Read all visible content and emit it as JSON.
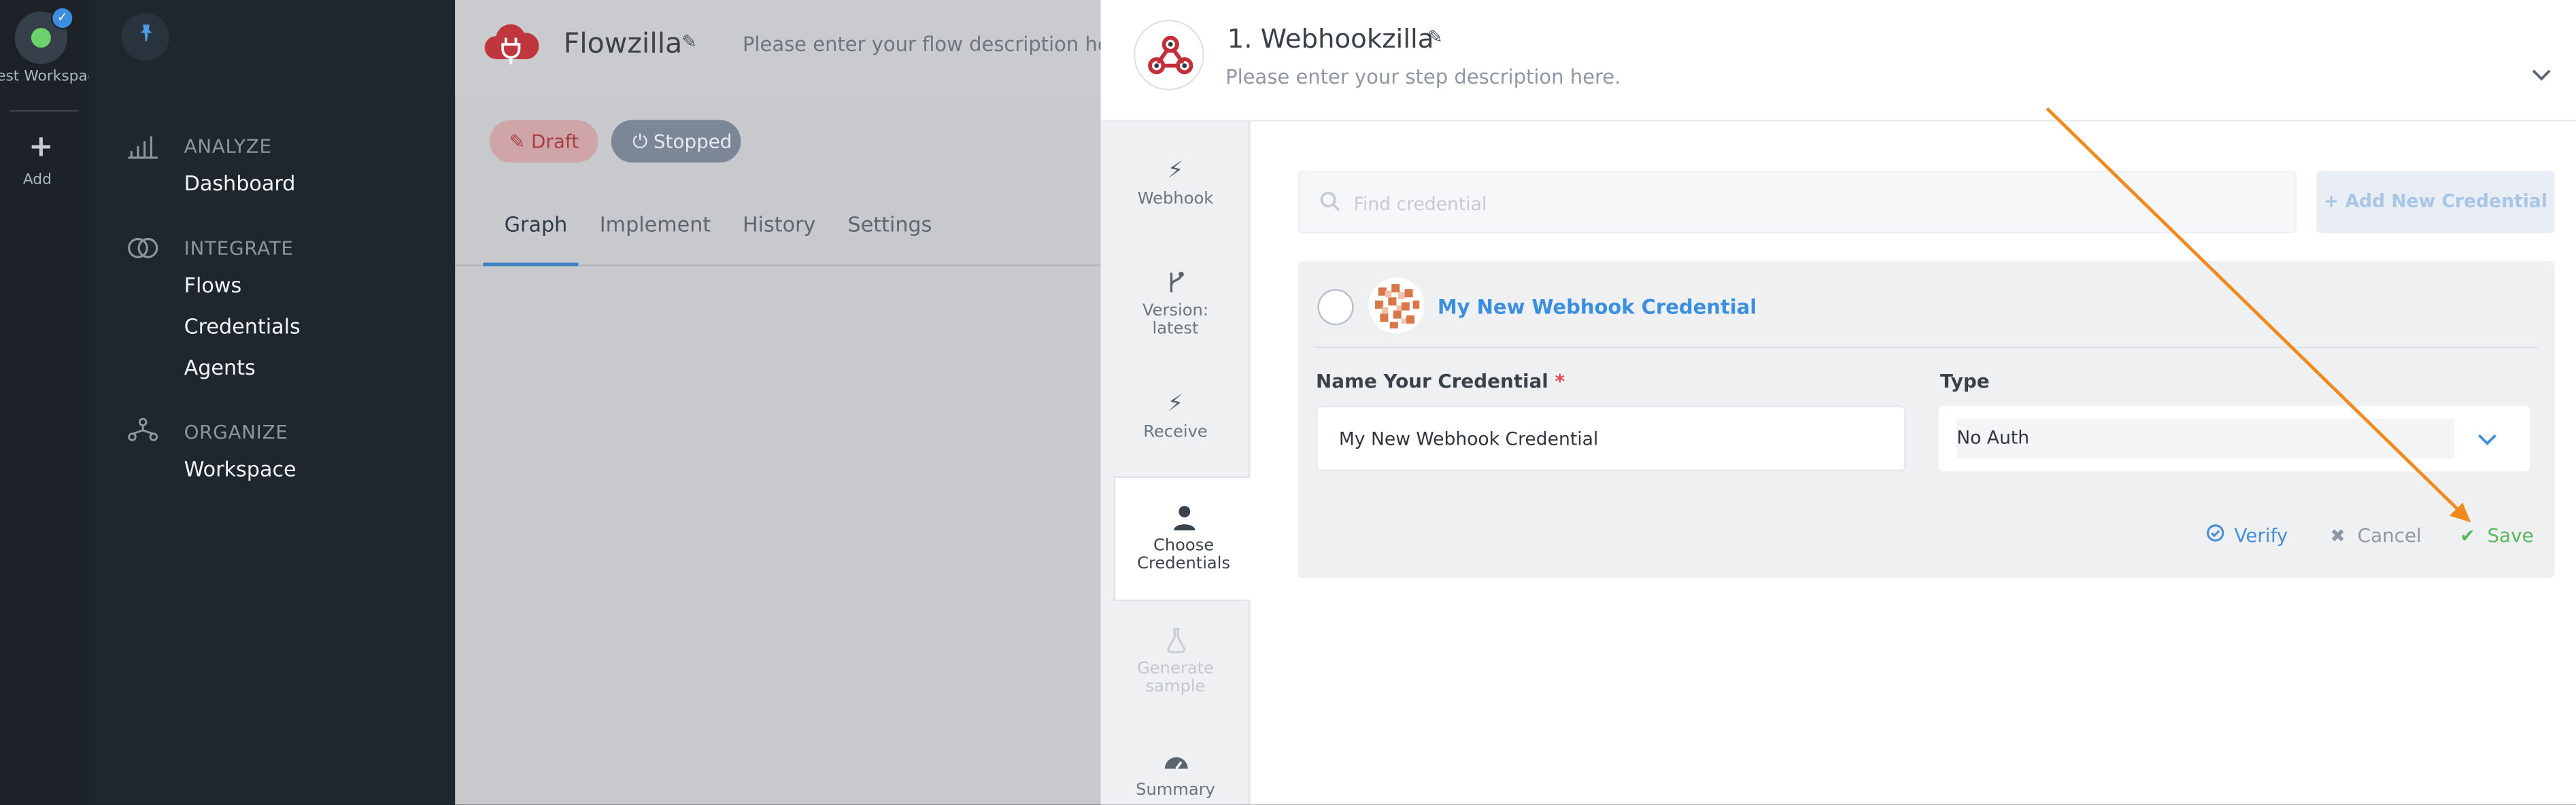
{
  "rail": {
    "workspace_label": "Test Workspace",
    "add_label": "Add"
  },
  "nav": {
    "sections": [
      {
        "title": "ANALYZE",
        "icon": "bar-chart-icon",
        "items": [
          "Dashboard"
        ]
      },
      {
        "title": "INTEGRATE",
        "icon": "rings-icon",
        "items": [
          "Flows",
          "Credentials",
          "Agents"
        ]
      },
      {
        "title": "ORGANIZE",
        "icon": "org-chart-icon",
        "items": [
          "Workspace"
        ]
      }
    ]
  },
  "flow": {
    "title": "Flowzilla",
    "description": "Please enter your flow description here.",
    "status_draft": "Draft",
    "status_stopped": "Stopped",
    "tabs": [
      "Graph",
      "Implement",
      "History",
      "Settings"
    ],
    "active_tab": "Graph"
  },
  "step": {
    "title": "1. Webhookzilla",
    "description": "Please enter your step description here.",
    "side_items": [
      {
        "label": "Webhook",
        "icon": "lightning-icon"
      },
      {
        "label": "Version: latest",
        "icon": "branch-icon"
      },
      {
        "label": "Receive",
        "icon": "lightning-icon"
      },
      {
        "label": "Choose Credentials",
        "icon": "user-icon"
      },
      {
        "label": "Generate sample",
        "icon": "flask-icon"
      },
      {
        "label": "Summary",
        "icon": "gauge-icon"
      }
    ],
    "active_side_item": "Choose Credentials"
  },
  "credentials": {
    "search_placeholder": "Find credential",
    "add_new_label": "Add New Credential",
    "card": {
      "name": "My New Webhook Credential",
      "name_field_label": "Name Your Credential",
      "required_mark": "*",
      "name_value": "My New Webhook Credential",
      "type_field_label": "Type",
      "type_value": "No Auth",
      "verify_label": "Verify",
      "cancel_label": "Cancel",
      "save_label": "Save"
    }
  },
  "colors": {
    "accent": "#3b8fdf",
    "save": "#5cb85c",
    "annotation_arrow": "#f08a1c",
    "required": "#e0434e"
  }
}
